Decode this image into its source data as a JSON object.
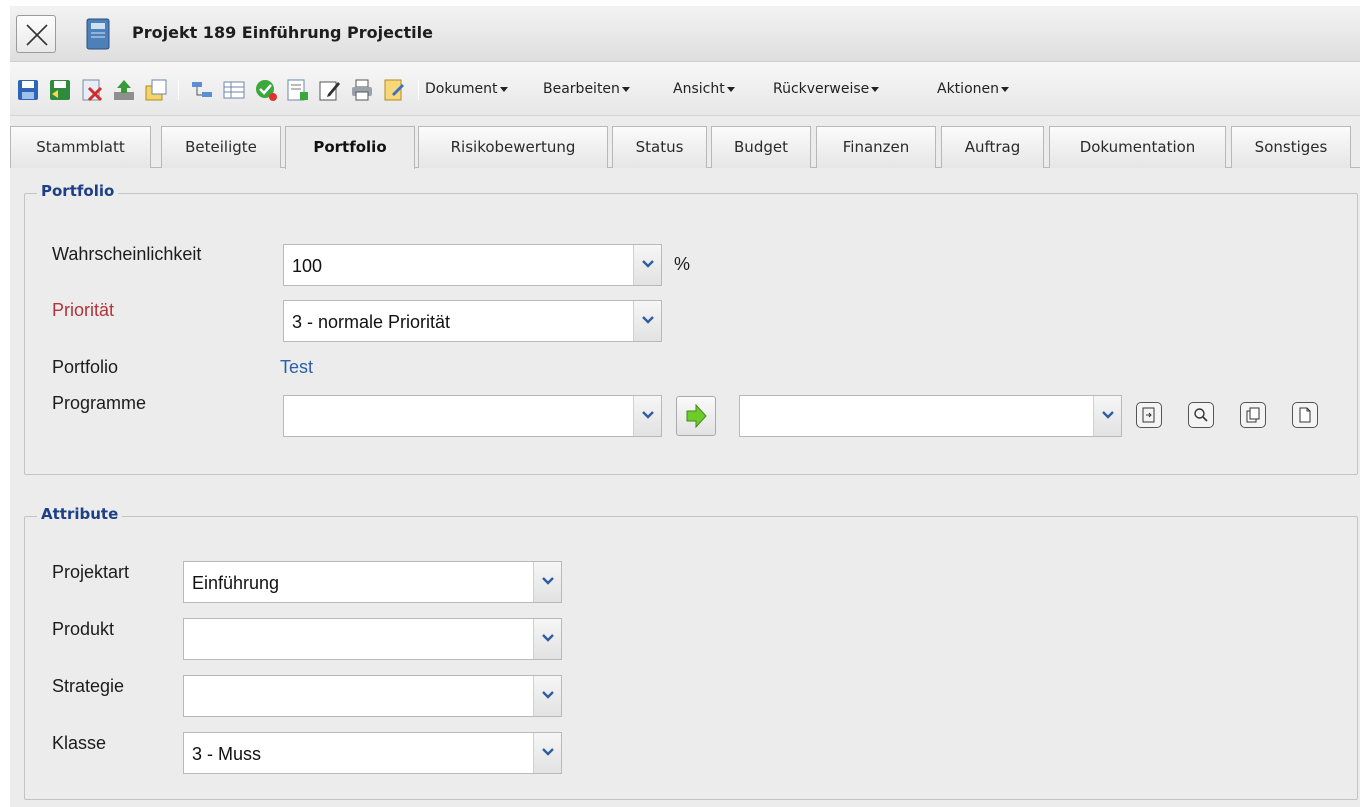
{
  "window": {
    "title": "Projekt 189 Einführung Projectile"
  },
  "toolbar": {
    "icons": [
      "save-icon",
      "save-back-icon",
      "delete-doc-icon",
      "upload-icon",
      "duplicate-icon",
      "tree-icon",
      "table-icon",
      "check-icon",
      "grid-report-icon",
      "edit-icon",
      "print-icon",
      "note-icon"
    ],
    "menus": [
      {
        "label": "Dokument"
      },
      {
        "label": "Bearbeiten"
      },
      {
        "label": "Ansicht"
      },
      {
        "label": "Rückverweise"
      },
      {
        "label": "Aktionen"
      }
    ]
  },
  "tabs": [
    {
      "label": "Stammblatt",
      "active": false
    },
    {
      "label": "Beteiligte",
      "active": false
    },
    {
      "label": "Portfolio",
      "active": true
    },
    {
      "label": "Risikobewertung",
      "active": false
    },
    {
      "label": "Status",
      "active": false
    },
    {
      "label": "Budget",
      "active": false
    },
    {
      "label": "Finanzen",
      "active": false
    },
    {
      "label": "Auftrag",
      "active": false
    },
    {
      "label": "Dokumentation",
      "active": false
    },
    {
      "label": "Sonstiges",
      "active": false
    }
  ],
  "portfolio_group": {
    "legend": "Portfolio",
    "wahrscheinlichkeit": {
      "label": "Wahrscheinlichkeit",
      "value": "100",
      "unit": "%"
    },
    "prioritaet": {
      "label": "Priorität",
      "value": "3 - normale Priorität"
    },
    "portfolio": {
      "label": "Portfolio",
      "value": "Test"
    },
    "programme": {
      "label": "Programme",
      "value1": "",
      "value2": ""
    }
  },
  "attribute_group": {
    "legend": "Attribute",
    "projektart": {
      "label": "Projektart",
      "value": "Einführung"
    },
    "produkt": {
      "label": "Produkt",
      "value": ""
    },
    "strategie": {
      "label": "Strategie",
      "value": ""
    },
    "klasse": {
      "label": "Klasse",
      "value": "3 - Muss"
    }
  },
  "colors": {
    "legend": "#1d3f86",
    "required_label": "#b1343a",
    "link": "#2b5fa8"
  }
}
